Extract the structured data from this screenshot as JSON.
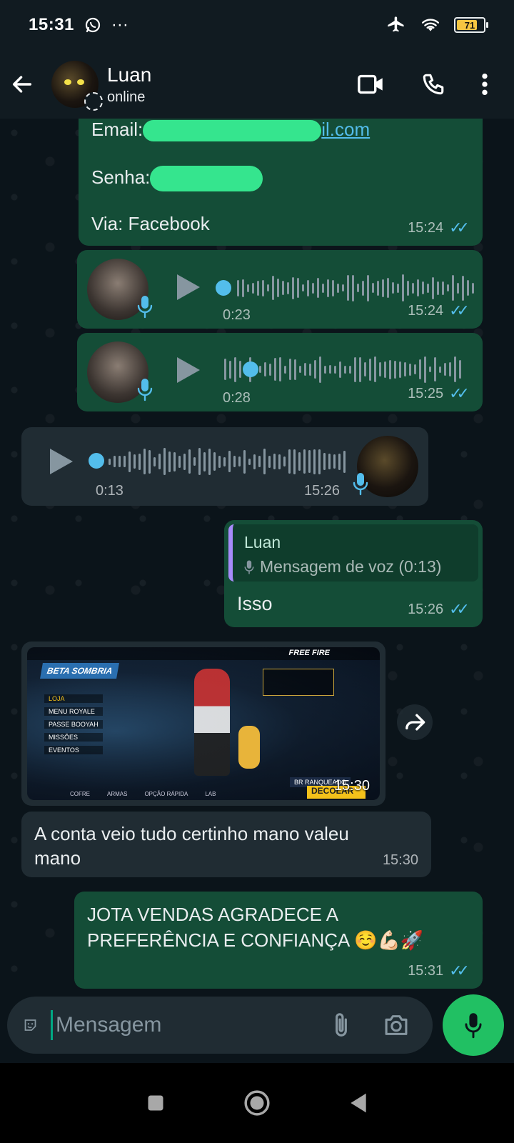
{
  "status_bar": {
    "time": "15:31",
    "more": "···",
    "battery_percent": "71"
  },
  "header": {
    "name": "Luan",
    "status": "online"
  },
  "messages": {
    "credentials": {
      "email_label": "Email:",
      "email_suffix": "il.com",
      "password_label": "Senha:",
      "via": "Via: Facebook",
      "time": "15:24"
    },
    "voice1": {
      "duration": "0:23",
      "time": "15:24",
      "progress": 0
    },
    "voice2": {
      "duration": "0:28",
      "time": "15:25",
      "progress": 0.1
    },
    "voice3": {
      "duration": "0:13",
      "time": "15:26",
      "progress": 0
    },
    "reply": {
      "quoted_author": "Luan",
      "quoted_text": "Mensagem de voz (0:13)",
      "text": "Isso",
      "time": "15:26"
    },
    "image": {
      "time": "15:30",
      "game_logo": "FREE FIRE",
      "game_banner": "BETA SOMBRIA",
      "menu_items": [
        "LOJA",
        "MENU ROYALE",
        "PASSE BOOYAH",
        "MISSÕES",
        "EVENTOS"
      ],
      "bottom_tabs": [
        "COFRE",
        "ARMAS",
        "OPÇÃO RÁPIDA",
        "LAB"
      ],
      "rank_label": "BR RANQUEADO",
      "start_button": "DECOLAR"
    },
    "incoming_text": {
      "text": "A conta veio tudo certinho mano valeu mano",
      "time": "15:30"
    },
    "final": {
      "text": "JOTA VENDAS AGRADECE A PREFERÊNCIA E CONFIANÇA ☺️💪🏻🚀",
      "time": "15:31"
    }
  },
  "composer": {
    "placeholder": "Mensagem"
  },
  "colors": {
    "outgoing_bubble": "#144d37",
    "incoming_bubble": "#202c33",
    "accent_green": "#21c063",
    "read_ticks": "#53bdeb"
  },
  "icons": [
    "whatsapp-icon",
    "airplane-icon",
    "wifi-icon",
    "back-arrow-icon",
    "video-call-icon",
    "phone-icon",
    "more-vert-icon",
    "play-icon",
    "mic-icon",
    "forward-icon",
    "sticker-icon",
    "attach-icon",
    "camera-icon",
    "square-nav-icon",
    "home-nav-icon",
    "back-nav-icon"
  ]
}
